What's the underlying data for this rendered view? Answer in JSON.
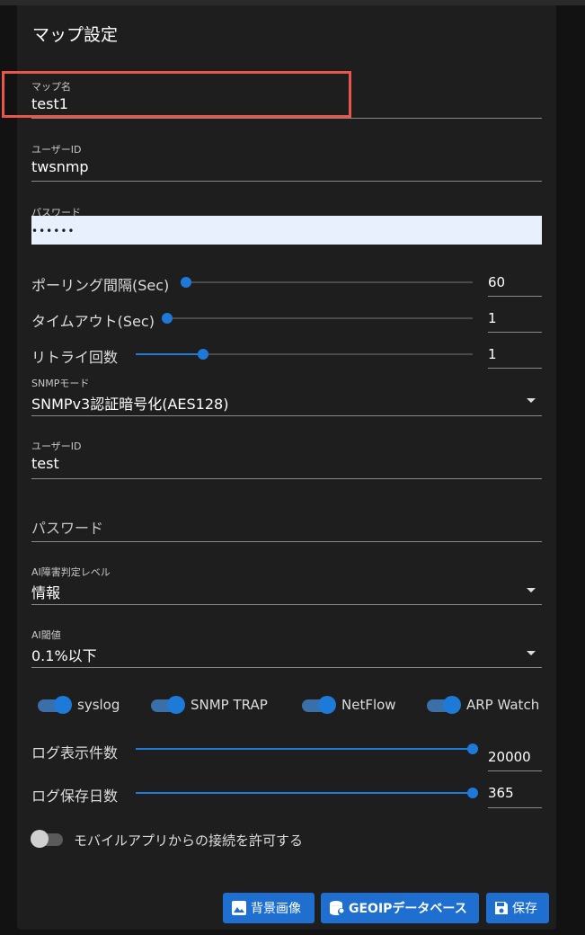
{
  "title": "マップ設定",
  "fields": {
    "map_name": {
      "label": "マップ名",
      "value": "test1"
    },
    "user_id": {
      "label": "ユーザーID",
      "value": "twsnmp"
    },
    "password": {
      "label": "パスワード",
      "value": "••••••"
    },
    "snmp_mode": {
      "label": "SNMPモード",
      "value": "SNMPv3認証暗号化(AES128)"
    },
    "snmp_user_id": {
      "label": "ユーザーID",
      "value": "test"
    },
    "snmp_password": {
      "placeholder": "パスワード"
    },
    "ai_level": {
      "label": "AI障害判定レベル",
      "value": "情報"
    },
    "ai_threshold": {
      "label": "AI閾値",
      "value": "0.1%以下"
    }
  },
  "sliders": {
    "polling": {
      "label": "ポーリング間隔(Sec)",
      "value": "60",
      "fraction": 0.0
    },
    "timeout": {
      "label": "タイムアウト(Sec)",
      "value": "1",
      "fraction": 0.0
    },
    "retry": {
      "label": "リトライ回数",
      "value": "1",
      "fraction": 0.2
    },
    "log_count": {
      "label": "ログ表示件数",
      "value": "20000",
      "fraction": 1.0
    },
    "log_days": {
      "label": "ログ保存日数",
      "value": "365",
      "fraction": 1.0
    }
  },
  "toggles": {
    "syslog": {
      "label": "syslog",
      "on": true
    },
    "snmp_trap": {
      "label": "SNMP TRAP",
      "on": true
    },
    "netflow": {
      "label": "NetFlow",
      "on": true
    },
    "arp_watch": {
      "label": "ARP Watch",
      "on": true
    },
    "mobile": {
      "label": "モバイルアプリからの接続を許可する",
      "on": false
    }
  },
  "buttons": {
    "background": "背景画像",
    "geoip": "GEOIPデータベース",
    "save": "保存"
  },
  "colors": {
    "accent": "#1e7ad8",
    "highlight": "#e8574a",
    "button": "#1e6fcf"
  }
}
